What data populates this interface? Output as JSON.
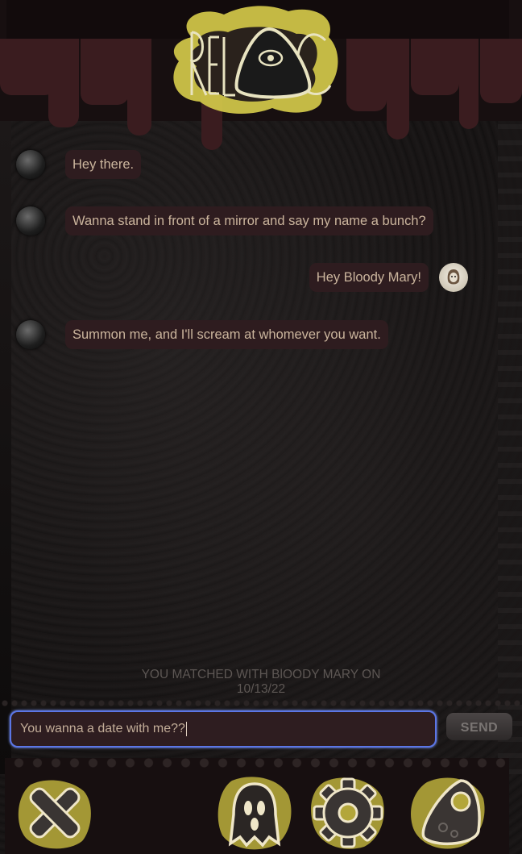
{
  "app": {
    "logo_text": "RELIC"
  },
  "messages": [
    {
      "side": "left",
      "text": "Hey there.",
      "avatar": "ghost-avatar"
    },
    {
      "side": "left",
      "text": "Wanna stand in front of a mirror and say my name a bunch?",
      "avatar": "ghost-avatar"
    },
    {
      "side": "right",
      "text": "Hey Bloody Mary!",
      "avatar": "user-avatar"
    },
    {
      "side": "left",
      "text": "Summon me, and I'll scream at whomever you want.",
      "avatar": "ghost-avatar"
    }
  ],
  "match_notice": {
    "line1": "YOU MATCHED WITH BlOODY MARY ON",
    "line2": "10/13/22"
  },
  "composer": {
    "value": "You wanna a date with me??",
    "send_label": "SEND"
  },
  "nav": [
    {
      "name": "unmatch-x-icon"
    },
    {
      "name": "ghost-profile-icon"
    },
    {
      "name": "settings-gear-icon"
    },
    {
      "name": "planchette-icon"
    }
  ],
  "colors": {
    "accent": "#5b76e6",
    "bubble": "#2e1c1f",
    "text": "#cbb59d",
    "splatter": "#b3a63a"
  }
}
